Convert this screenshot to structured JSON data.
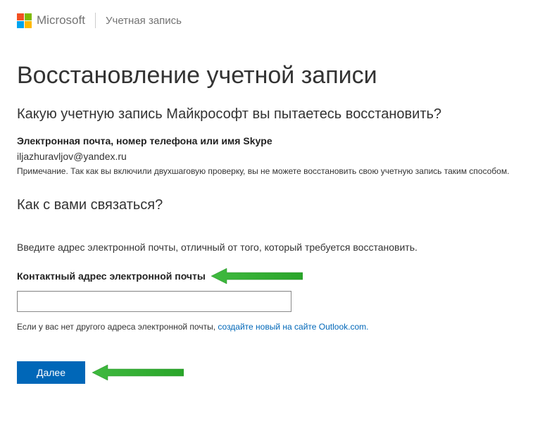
{
  "header": {
    "brand": "Microsoft",
    "section": "Учетная запись"
  },
  "main": {
    "title": "Восстановление учетной записи",
    "question": "Какую учетную запись Майкрософт вы пытаетесь восстановить?",
    "account_label": "Электронная почта, номер телефона или имя Skype",
    "account_value": "iljazhuravljov@yandex.ru",
    "note": "Примечание. Так как вы включили двухшаговую проверку, вы не можете восстановить свою учетную запись таким способом."
  },
  "contact": {
    "title": "Как с вами связаться?",
    "instruction": "Введите адрес электронной почты, отличный от того, который требуется восстановить.",
    "label": "Контактный адрес электронной почты",
    "input_value": "",
    "helper_prefix": "Если у вас нет другого адреса электронной почты, ",
    "helper_link": "создайте новый на сайте Outlook.com."
  },
  "button": {
    "next": "Далее"
  }
}
